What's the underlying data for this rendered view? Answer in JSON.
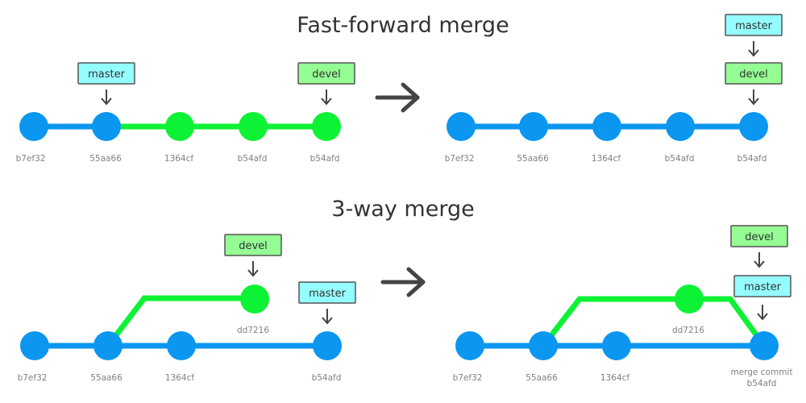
{
  "colors": {
    "master_commit": "#0b96ef",
    "devel_commit": "#0ef235",
    "master_label_bg": "#94fdff",
    "devel_label_bg": "#94fd94",
    "label_border": "#555555",
    "arrow": "#444444",
    "hash_text": "#808080"
  },
  "sections": [
    {
      "title": "Fast-forward merge",
      "before": {
        "commits": [
          {
            "hash": "b7ef32",
            "branch": "master"
          },
          {
            "hash": "55aa66",
            "branch": "master"
          },
          {
            "hash": "1364cf",
            "branch": "devel"
          },
          {
            "hash": "b54afd",
            "branch": "devel"
          },
          {
            "hash": "b54afd",
            "branch": "devel"
          }
        ],
        "labels": [
          {
            "text": "master",
            "branch": "master",
            "points_to": "55aa66"
          },
          {
            "text": "devel",
            "branch": "devel",
            "points_to": "b54afd"
          }
        ]
      },
      "after": {
        "commits": [
          {
            "hash": "b7ef32",
            "branch": "master"
          },
          {
            "hash": "55aa66",
            "branch": "master"
          },
          {
            "hash": "1364cf",
            "branch": "master"
          },
          {
            "hash": "b54afd",
            "branch": "master"
          },
          {
            "hash": "b54afd",
            "branch": "master"
          }
        ],
        "labels": [
          {
            "text": "master",
            "branch": "master",
            "points_to": "devel"
          },
          {
            "text": "devel",
            "branch": "devel",
            "points_to": "b54afd"
          }
        ]
      }
    },
    {
      "title": "3-way merge",
      "before": {
        "commits": [
          {
            "hash": "b7ef32",
            "branch": "master"
          },
          {
            "hash": "55aa66",
            "branch": "master"
          },
          {
            "hash": "1364cf",
            "branch": "master"
          },
          {
            "hash": "b54afd",
            "branch": "master"
          },
          {
            "hash": "dd7216",
            "branch": "devel"
          }
        ],
        "labels": [
          {
            "text": "devel",
            "branch": "devel",
            "points_to": "dd7216"
          },
          {
            "text": "master",
            "branch": "master",
            "points_to": "b54afd"
          }
        ]
      },
      "after": {
        "commits": [
          {
            "hash": "b7ef32",
            "branch": "master"
          },
          {
            "hash": "55aa66",
            "branch": "master"
          },
          {
            "hash": "1364cf",
            "branch": "master"
          },
          {
            "hash": "dd7216",
            "branch": "devel"
          },
          {
            "hash": "b54afd",
            "branch": "master",
            "note": "merge commit"
          }
        ],
        "labels": [
          {
            "text": "devel",
            "branch": "devel",
            "points_to": "master"
          },
          {
            "text": "master",
            "branch": "master",
            "points_to": "b54afd"
          }
        ]
      }
    }
  ],
  "transition_icon": "right-arrow-icon"
}
